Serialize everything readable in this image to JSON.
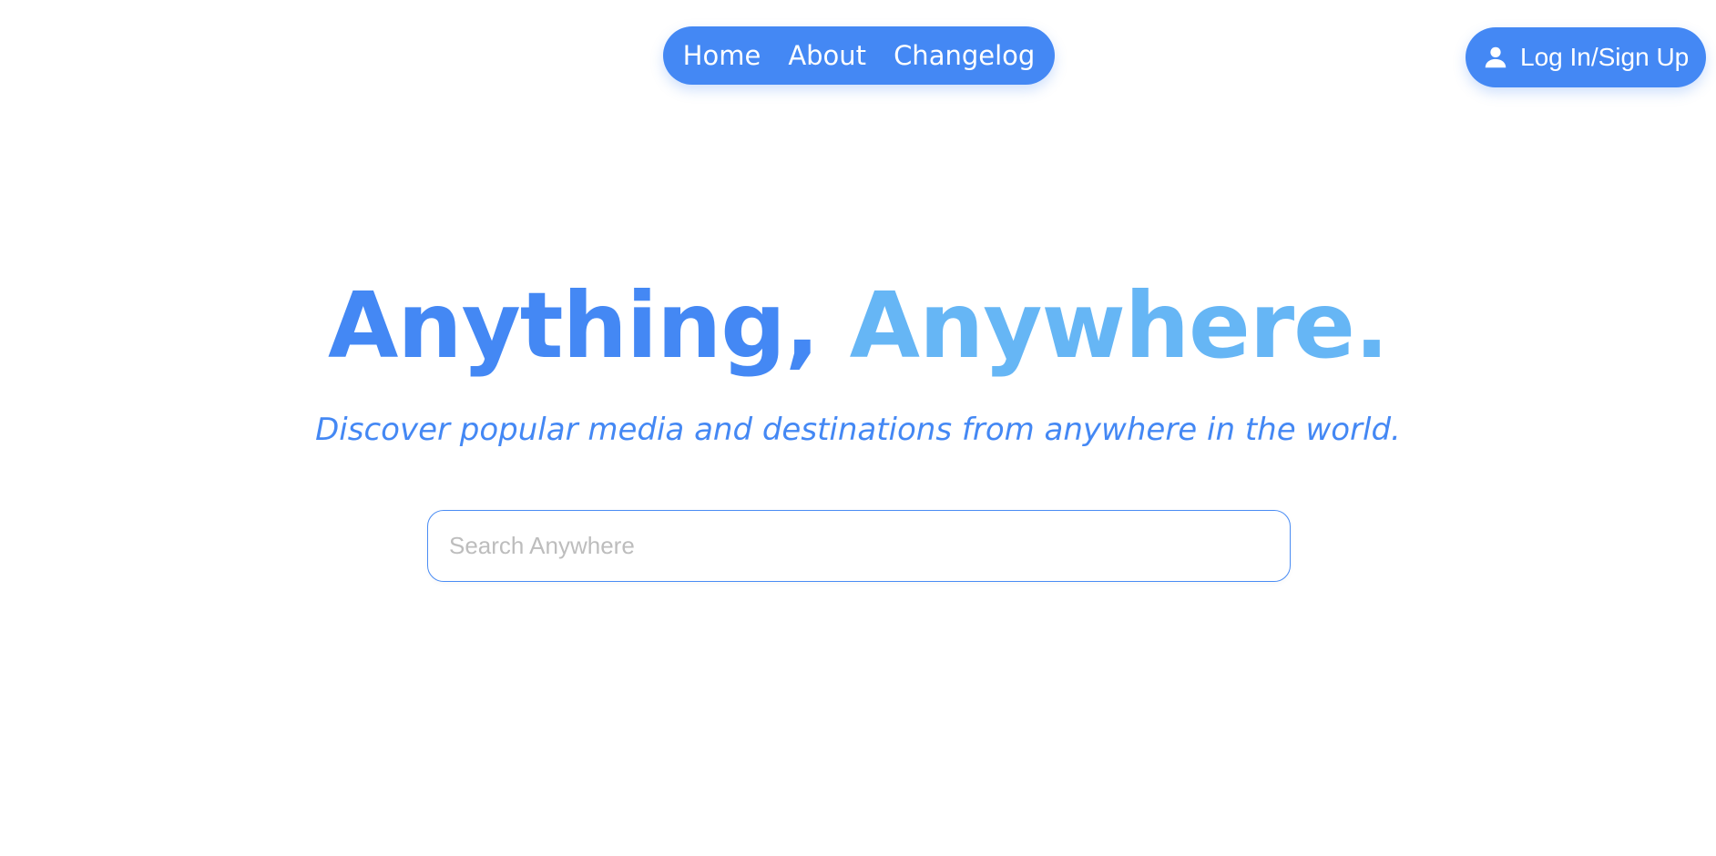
{
  "nav": {
    "links": [
      {
        "label": "Home"
      },
      {
        "label": "About"
      },
      {
        "label": "Changelog"
      }
    ]
  },
  "auth": {
    "login_label": "Log In/Sign Up",
    "icon": "user-icon"
  },
  "hero": {
    "title_part1": "Anything,",
    "title_part2": "Anywhere.",
    "subtitle": "Discover popular media and destinations from anywhere in the world."
  },
  "search": {
    "placeholder": "Search Anywhere",
    "value": ""
  },
  "colors": {
    "primary": "#4488f4",
    "accent_light": "#66b6f5",
    "background": "#ffffff",
    "placeholder": "#bdbdbd"
  }
}
